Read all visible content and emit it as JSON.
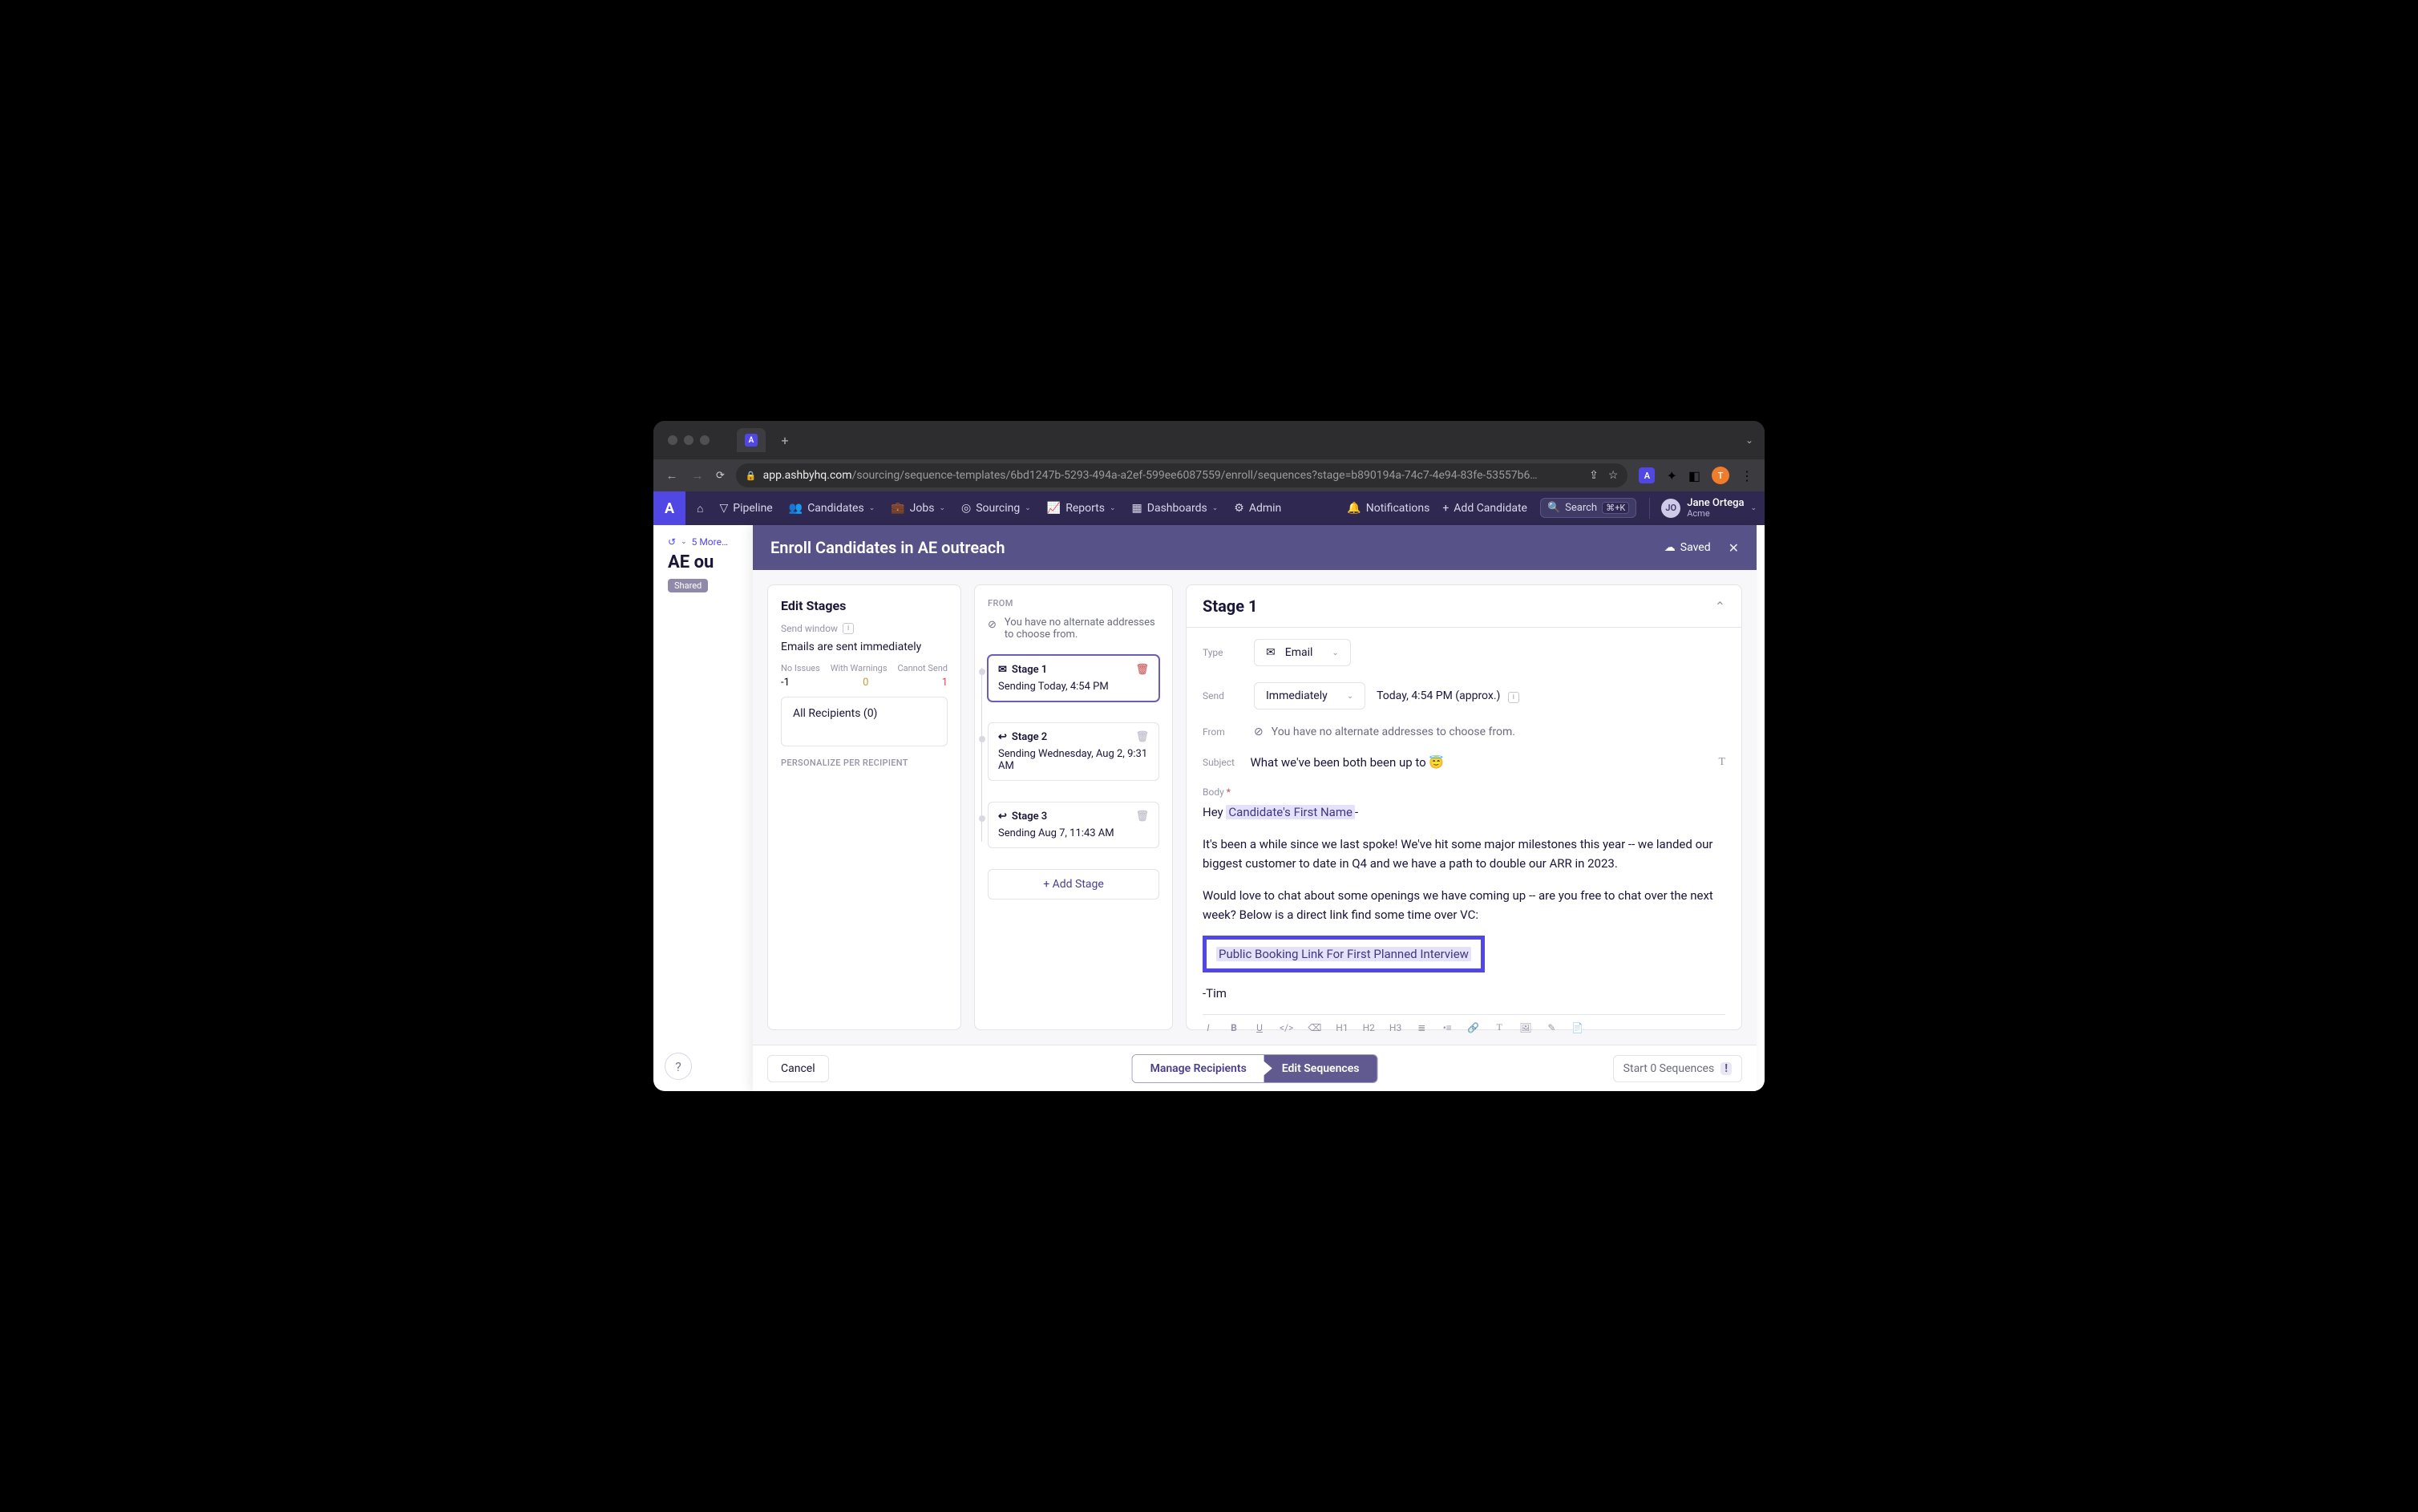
{
  "browser": {
    "url_host": "app.ashbyhq.com",
    "url_path": "/sourcing/sequence-templates/6bd1247b-5293-494a-a2ef-599ee6087559/enroll/sequences?stage=b890194a-74c7-4e94-83fe-53557b6…",
    "avatar_initial": "T",
    "ext_label": "A"
  },
  "header": {
    "nav": {
      "pipeline": "Pipeline",
      "candidates": "Candidates",
      "jobs": "Jobs",
      "sourcing": "Sourcing",
      "reports": "Reports",
      "dashboards": "Dashboards",
      "admin": "Admin"
    },
    "notifications": "Notifications",
    "add_candidate": "Add Candidate",
    "search": "Search",
    "search_kbd": "⌘+K",
    "user": {
      "initials": "JO",
      "name": "Jane Ortega",
      "org": "Acme"
    }
  },
  "page_behind": {
    "breadcrumb_more": "5 More…",
    "title": "AE ou",
    "shared": "Shared"
  },
  "modal": {
    "title": "Enroll Candidates in AE outreach",
    "saved": "Saved"
  },
  "left": {
    "title": "Edit Stages",
    "send_window_label": "Send window",
    "send_window_desc": "Emails are sent immediately",
    "status_labels": {
      "none": "No Issues",
      "warn": "With Warnings",
      "cannot": "Cannot Send"
    },
    "status_values": {
      "none": "-1",
      "warn": "0",
      "cannot": "1"
    },
    "recipients": "All Recipients (0)",
    "personalize": "PERSONALIZE PER RECIPIENT"
  },
  "mid": {
    "from_label": "FROM",
    "from_text": "You have no alternate addresses to choose from.",
    "stages": [
      {
        "name": "Stage 1",
        "sub": "Sending Today, 4:54 PM"
      },
      {
        "name": "Stage 2",
        "sub": "Sending Wednesday, Aug 2, 9:31 AM"
      },
      {
        "name": "Stage 3",
        "sub": "Sending Aug 7, 11:43 AM"
      }
    ],
    "add_stage": "+ Add Stage"
  },
  "right": {
    "heading": "Stage 1",
    "labels": {
      "type": "Type",
      "send": "Send",
      "from": "From",
      "subject": "Subject",
      "body": "Body"
    },
    "type_value": "Email",
    "send_value": "Immediately",
    "send_approx": "Today, 4:54 PM (approx.)",
    "from_text": "You have no alternate addresses to choose from.",
    "subject": "What we've been both been up to 😇",
    "body": {
      "greeting_pre": "Hey ",
      "greeting_token": "Candidate's First Name",
      "greeting_post": "-",
      "para1": "It's been a while since we last spoke! We've hit some major milestones this year -- we landed our biggest customer to date in Q4 and we have a path to double our ARR in 2023.",
      "para2": "Would love to chat about some openings we have coming up -- are you free to chat over the next week? Below is a direct link find some time over VC:",
      "booking_token": "Public Booking Link For First Planned Interview",
      "signoff": "-Tim"
    }
  },
  "footer": {
    "cancel": "Cancel",
    "manage": "Manage Recipients",
    "edit": "Edit Sequences",
    "start": "Start 0 Sequences",
    "warn": "!"
  }
}
